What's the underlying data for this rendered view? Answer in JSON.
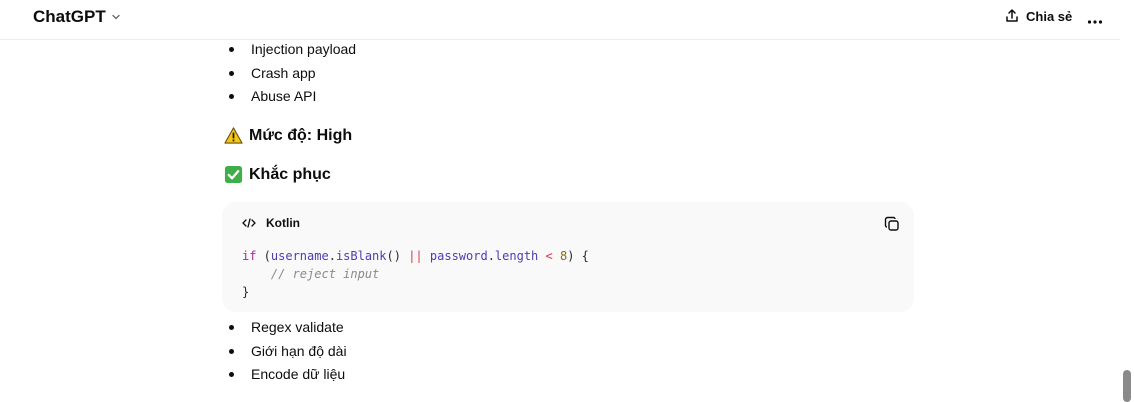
{
  "header": {
    "brand": "ChatGPT",
    "share_label": "Chia sẻ"
  },
  "list_top": [
    "Injection payload",
    "Crash app",
    "Abuse API"
  ],
  "severity": {
    "icon": "warning-emoji",
    "text": "Mức độ: High"
  },
  "fix": {
    "icon": "check-mark-emoji",
    "text": "Khắc phục"
  },
  "code": {
    "language": "Kotlin",
    "lines": [
      "if (username.isBlank() || password.length < 8) {",
      "    // reject input",
      "}"
    ]
  },
  "list_bottom": [
    "Regex validate",
    "Giới hạn độ dài",
    "Encode dữ liệu"
  ],
  "colors": {
    "warning": "#f5c518",
    "check": "#3fae49",
    "code_bg": "#f9f9f9"
  }
}
